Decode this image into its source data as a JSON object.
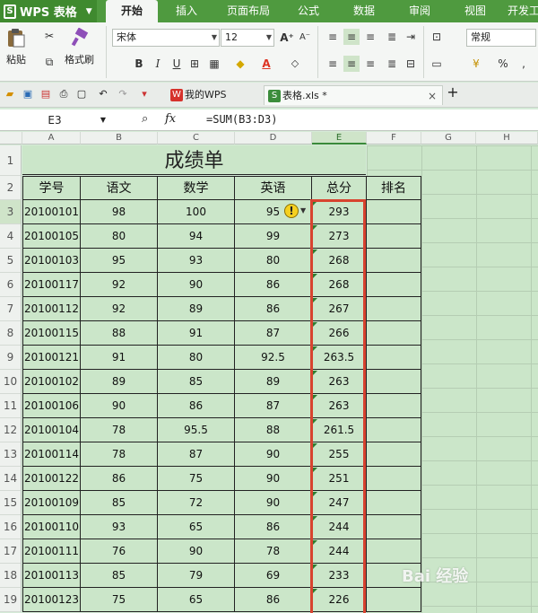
{
  "app": {
    "name": "WPS 表格"
  },
  "tabs": [
    "开始",
    "插入",
    "页面布局",
    "公式",
    "数据",
    "审阅",
    "视图",
    "开发工"
  ],
  "ribbon": {
    "paste": "粘贴",
    "format_painter": "格式刷",
    "font_name": "宋体",
    "font_size": "12",
    "number_format": "常规",
    "bold": "B",
    "italic": "I",
    "underline": "U",
    "percent": "%",
    "comma": ","
  },
  "doc_tabs": [
    {
      "label": "我的WPS"
    },
    {
      "label": "表格.xls *"
    }
  ],
  "formula_bar": {
    "cell_ref": "E3",
    "fx": "fx",
    "formula": "=SUM(B3:D3)"
  },
  "columns": [
    "A",
    "B",
    "C",
    "D",
    "E",
    "F",
    "G",
    "H"
  ],
  "rows": [
    "1",
    "2",
    "3",
    "4",
    "5",
    "6",
    "7",
    "8",
    "9",
    "10",
    "11",
    "12",
    "13",
    "14",
    "15",
    "16",
    "17",
    "18",
    "19"
  ],
  "sheet": {
    "title": "成绩单",
    "headers": [
      "学号",
      "语文",
      "数学",
      "英语",
      "总分",
      "排名"
    ],
    "data": [
      [
        "20100101",
        "98",
        "100",
        "95",
        "293"
      ],
      [
        "20100105",
        "80",
        "94",
        "99",
        "273"
      ],
      [
        "20100103",
        "95",
        "93",
        "80",
        "268"
      ],
      [
        "20100117",
        "92",
        "90",
        "86",
        "268"
      ],
      [
        "20100112",
        "92",
        "89",
        "86",
        "267"
      ],
      [
        "20100115",
        "88",
        "91",
        "87",
        "266"
      ],
      [
        "20100121",
        "91",
        "80",
        "92.5",
        "263.5"
      ],
      [
        "20100102",
        "89",
        "85",
        "89",
        "263"
      ],
      [
        "20100106",
        "90",
        "86",
        "87",
        "263"
      ],
      [
        "20100104",
        "78",
        "95.5",
        "88",
        "261.5"
      ],
      [
        "20100114",
        "78",
        "87",
        "90",
        "255"
      ],
      [
        "20100122",
        "86",
        "75",
        "90",
        "251"
      ],
      [
        "20100109",
        "85",
        "72",
        "90",
        "247"
      ],
      [
        "20100110",
        "93",
        "65",
        "86",
        "244"
      ],
      [
        "20100111",
        "76",
        "90",
        "78",
        "244"
      ],
      [
        "20100113",
        "85",
        "79",
        "69",
        "233"
      ],
      [
        "20100123",
        "75",
        "65",
        "86",
        "226"
      ]
    ]
  },
  "colors": {
    "accent": "#4f9a3f",
    "selection": "#d8432f",
    "cell_bg": "#cbe6c9"
  },
  "watermark": "Bai 经验"
}
